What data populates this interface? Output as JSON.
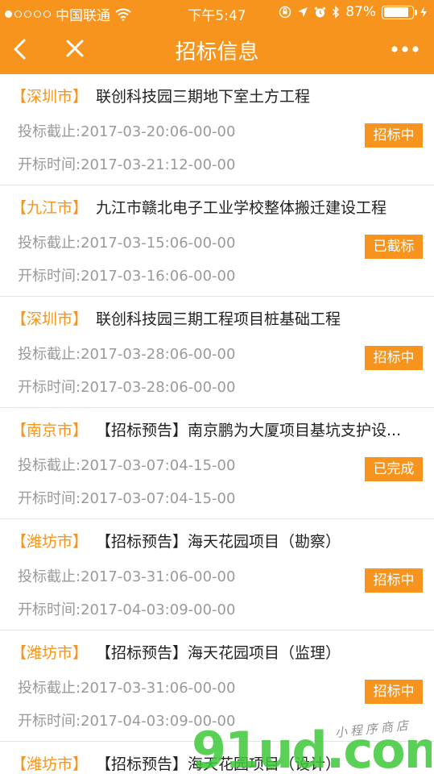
{
  "status_bar": {
    "carrier": "中国联通",
    "time": "下午5:47",
    "battery": "87%",
    "battery_level": 0.87
  },
  "nav": {
    "title": "招标信息",
    "back_icon": "back-arrow-icon",
    "close_icon": "close-icon",
    "more_icon": "more-dots-icon"
  },
  "items": [
    {
      "city": "【深圳市】",
      "name": "联创科技园三期地下室土方工程",
      "deadline": "投标截止:2017-03-20:06-00-00",
      "open": "开标时间:2017-03-21:12-00-00",
      "status": "招标中"
    },
    {
      "city": "【九江市】",
      "name": "九江市赣北电子工业学校整体搬迁建设工程",
      "deadline": "投标截止:2017-03-15:06-00-00",
      "open": "开标时间:2017-03-16:06-00-00",
      "status": "已截标"
    },
    {
      "city": "【深圳市】",
      "name": "联创科技园三期工程项目桩基础工程",
      "deadline": "投标截止:2017-03-28:06-00-00",
      "open": "开标时间:2017-03-28:06-00-00",
      "status": "招标中"
    },
    {
      "city": "【南京市】",
      "name": "【招标预告】南京鹏为大厦项目基坑支护设...",
      "deadline": "投标截止:2017-03-07:04-15-00",
      "open": "开标时间:2017-03-07:04-15-00",
      "status": "已完成"
    },
    {
      "city": "【潍坊市】",
      "name": "【招标预告】海天花园项目（勘察）",
      "deadline": "投标截止:2017-03-31:06-00-00",
      "open": "开标时间:2017-04-03:09-00-00",
      "status": "招标中"
    },
    {
      "city": "【潍坊市】",
      "name": "【招标预告】海天花园项目（监理）",
      "deadline": "投标截止:2017-03-31:06-00-00",
      "open": "开标时间:2017-04-03:09-00-00",
      "status": "招标中"
    },
    {
      "city": "【潍坊市】",
      "name": "【招标预告】海天花园项目（设计）",
      "deadline": "",
      "open": "",
      "status": ""
    }
  ],
  "watermark": {
    "main": "91ud.com",
    "sub": "小程序商店"
  },
  "colors": {
    "accent": "#f7941d",
    "watermark_green": "#3ec83a"
  }
}
